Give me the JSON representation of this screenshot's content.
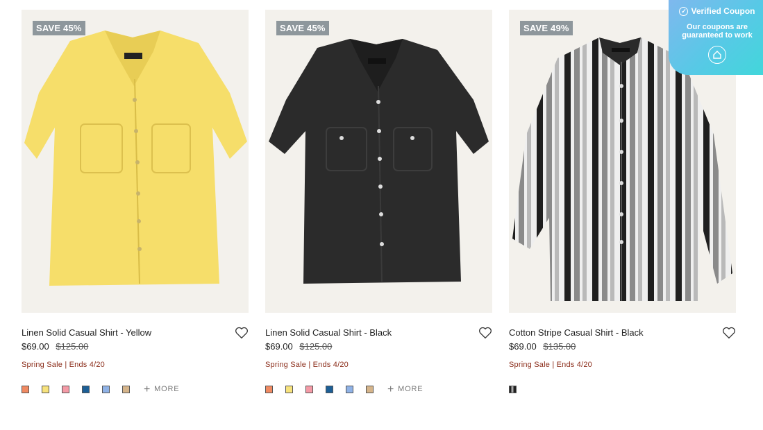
{
  "products": [
    {
      "badge": "SAVE 45%",
      "name": "Linen Solid Casual Shirt - Yellow",
      "price_sale": "$69.00",
      "price_orig": "$125.00",
      "promo": "Spring Sale | Ends 4/20",
      "shirt_color": "#f6de6a",
      "swatches": [
        "#f08a62",
        "#f7e27c",
        "#f49aa6",
        "#1d5f96",
        "#8fb2e6",
        "#d5b48a"
      ],
      "more_label": "MORE"
    },
    {
      "badge": "SAVE 45%",
      "name": "Linen Solid Casual Shirt - Black",
      "price_sale": "$69.00",
      "price_orig": "$125.00",
      "promo": "Spring Sale | Ends 4/20",
      "shirt_color": "#2b2b2b",
      "swatches": [
        "#f08a62",
        "#f7e27c",
        "#f49aa6",
        "#1d5f96",
        "#8fb2e6",
        "#d5b48a"
      ],
      "more_label": "MORE"
    },
    {
      "badge": "SAVE 49%",
      "name": "Cotton Stripe Casual Shirt - Black",
      "price_sale": "$69.00",
      "price_orig": "$135.00",
      "promo": "Spring Sale | Ends 4/20",
      "shirt_color": "stripes",
      "swatches": [
        "#444444"
      ],
      "more_label": ""
    }
  ],
  "coupon": {
    "title": "Verified Coupon",
    "text": "Our coupons are guaranteed to work"
  }
}
